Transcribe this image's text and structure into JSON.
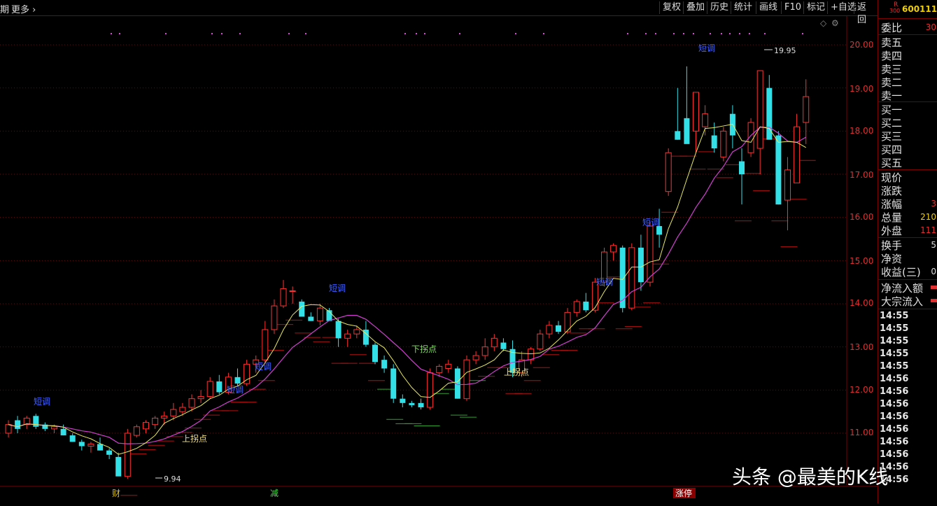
{
  "topbar": {
    "left_label_1": "期",
    "left_label_2": "更多",
    "buttons": [
      "复权",
      "叠加",
      "历史",
      "统计",
      "画线",
      "F10",
      "标记",
      "+自选",
      "返回"
    ]
  },
  "axis": {
    "price_labels": [
      "20.00",
      "19.00",
      "18.00",
      "17.00",
      "16.00",
      "15.00",
      "14.00",
      "13.00",
      "12.00",
      "11.00"
    ]
  },
  "annotations": {
    "duanshuo": "短调",
    "shangguai": "上拐点",
    "xiaguai": "下拐点",
    "high": "19.95",
    "low": "9.94",
    "bottom_tags": [
      "财",
      "减",
      "涨停"
    ]
  },
  "side": {
    "code_badge_r": "R",
    "code_badge_n": "300",
    "code": "600111",
    "weibi_label": "委比",
    "weibi_val": "30",
    "sell_labels": [
      "卖五",
      "卖四",
      "卖三",
      "卖二",
      "卖一"
    ],
    "buy_labels": [
      "买一",
      "买二",
      "买三",
      "买四",
      "买五"
    ],
    "stats_labels": [
      "现价",
      "涨跌",
      "涨幅",
      "总量",
      "外盘"
    ],
    "stats_vals": [
      "",
      "",
      "3",
      "210",
      "111"
    ],
    "stats2_labels": [
      "换手",
      "净资",
      "收益(三)"
    ],
    "stats2_vals": [
      "5",
      "",
      "0"
    ],
    "flow_labels": [
      "净流入额",
      "大宗流入"
    ],
    "times": [
      "14:55",
      "14:55",
      "14:55",
      "14:55",
      "14:55",
      "14:56",
      "14:56",
      "14:56",
      "14:56",
      "14:56",
      "14:56",
      "14:56",
      "14:56",
      "14:56"
    ]
  },
  "watermark": "头条 @最美的K线",
  "colors": {
    "up": "#ff3030",
    "down": "#33e0e8",
    "ma5": "#e8e860",
    "ma10": "#d040d0"
  }
}
